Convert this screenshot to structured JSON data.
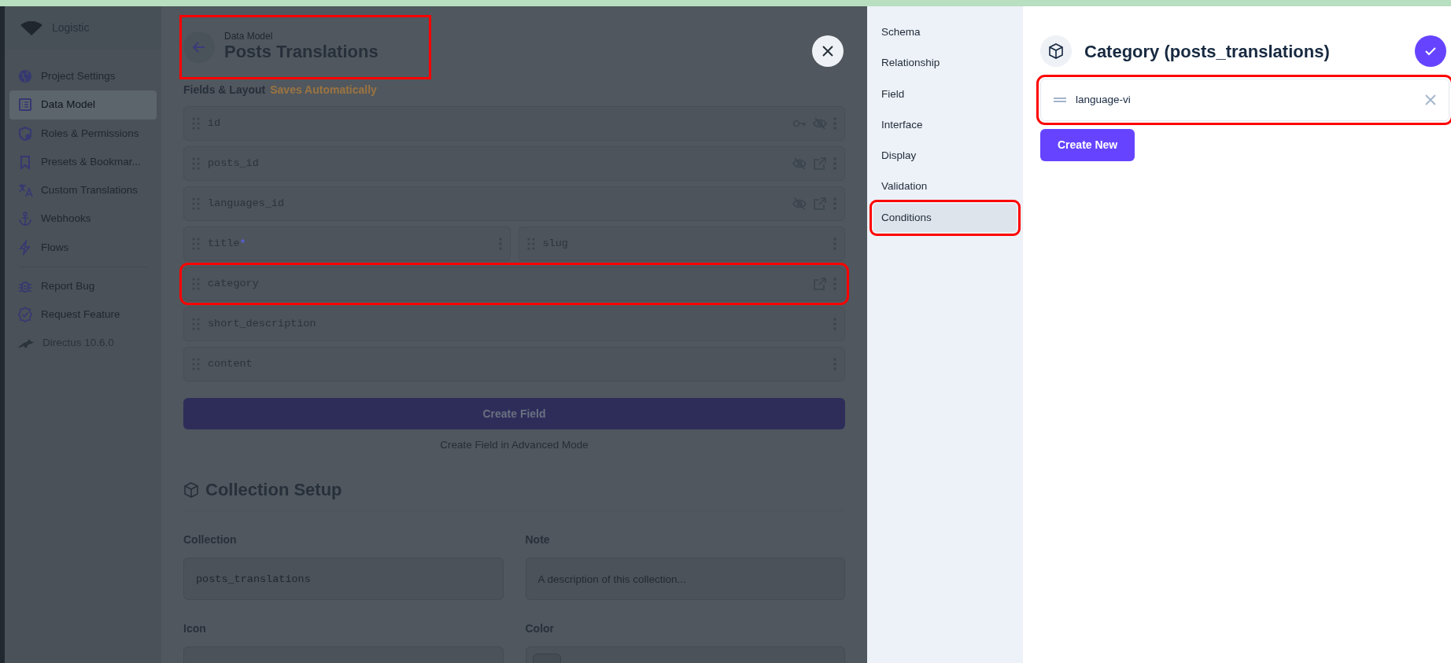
{
  "sidebar": {
    "project": "Logistic",
    "items": [
      {
        "label": "Project Settings",
        "kind": "globe",
        "selected": false
      },
      {
        "label": "Data Model",
        "kind": "list",
        "selected": true
      },
      {
        "label": "Roles & Permissions",
        "kind": "shield",
        "selected": false
      },
      {
        "label": "Presets & Bookmar...",
        "kind": "bookmark",
        "selected": false
      },
      {
        "label": "Custom Translations",
        "kind": "translate",
        "selected": false
      },
      {
        "label": "Webhooks",
        "kind": "anchor",
        "selected": false
      },
      {
        "label": "Flows",
        "kind": "bolt",
        "selected": false
      }
    ],
    "help_items": [
      {
        "label": "Report Bug",
        "kind": "bug"
      },
      {
        "label": "Request Feature",
        "kind": "badge"
      }
    ],
    "version": "Directus 10.6.0"
  },
  "header": {
    "breadcrumb": "Data Model",
    "title": "Posts Translations",
    "highlighted": true
  },
  "fields_heading": {
    "title": "Fields & Layout",
    "note": "Saves Automatically"
  },
  "field_rows": [
    [
      {
        "name": "id",
        "actions": [
          {
            "kind": "key"
          },
          {
            "kind": "hidden"
          }
        ],
        "highlighted": false
      }
    ],
    [
      {
        "name": "posts_id",
        "actions": [
          {
            "kind": "hidden"
          },
          {
            "kind": "open"
          }
        ],
        "highlighted": false
      }
    ],
    [
      {
        "name": "languages_id",
        "actions": [
          {
            "kind": "hidden"
          },
          {
            "kind": "open"
          }
        ],
        "highlighted": false
      }
    ],
    [
      {
        "name": "title",
        "marker": "*",
        "highlighted": false
      },
      {
        "name": "slug",
        "highlighted": false
      }
    ],
    [
      {
        "name": "category",
        "actions": [
          {
            "kind": "open"
          }
        ],
        "highlighted": true
      }
    ],
    [
      {
        "name": "short_description",
        "highlighted": false
      }
    ],
    [
      {
        "name": "content",
        "highlighted": false
      }
    ]
  ],
  "create_field_button": "Create Field",
  "advanced_link": "Create Field in Advanced Mode",
  "collection_setup": {
    "title": "Collection Setup",
    "fields": [
      {
        "label": "Collection",
        "value": "posts_translations"
      },
      {
        "label": "Note",
        "placeholder": "A description of this collection..."
      },
      {
        "label": "Icon"
      },
      {
        "label": "Color",
        "kind": "color"
      }
    ]
  },
  "drawer": {
    "nav": [
      {
        "label": "Schema",
        "selected": false,
        "highlighted": false
      },
      {
        "label": "Relationship",
        "selected": false,
        "highlighted": false
      },
      {
        "label": "Field",
        "selected": false,
        "highlighted": false
      },
      {
        "label": "Interface",
        "selected": false,
        "highlighted": false
      },
      {
        "label": "Display",
        "selected": false,
        "highlighted": false
      },
      {
        "label": "Validation",
        "selected": false,
        "highlighted": false
      },
      {
        "label": "Conditions",
        "selected": true,
        "highlighted": true
      }
    ],
    "title": "Category (posts_translations)",
    "items": [
      {
        "label": "language-vi",
        "highlighted": true
      }
    ],
    "create_button": "Create New"
  }
}
